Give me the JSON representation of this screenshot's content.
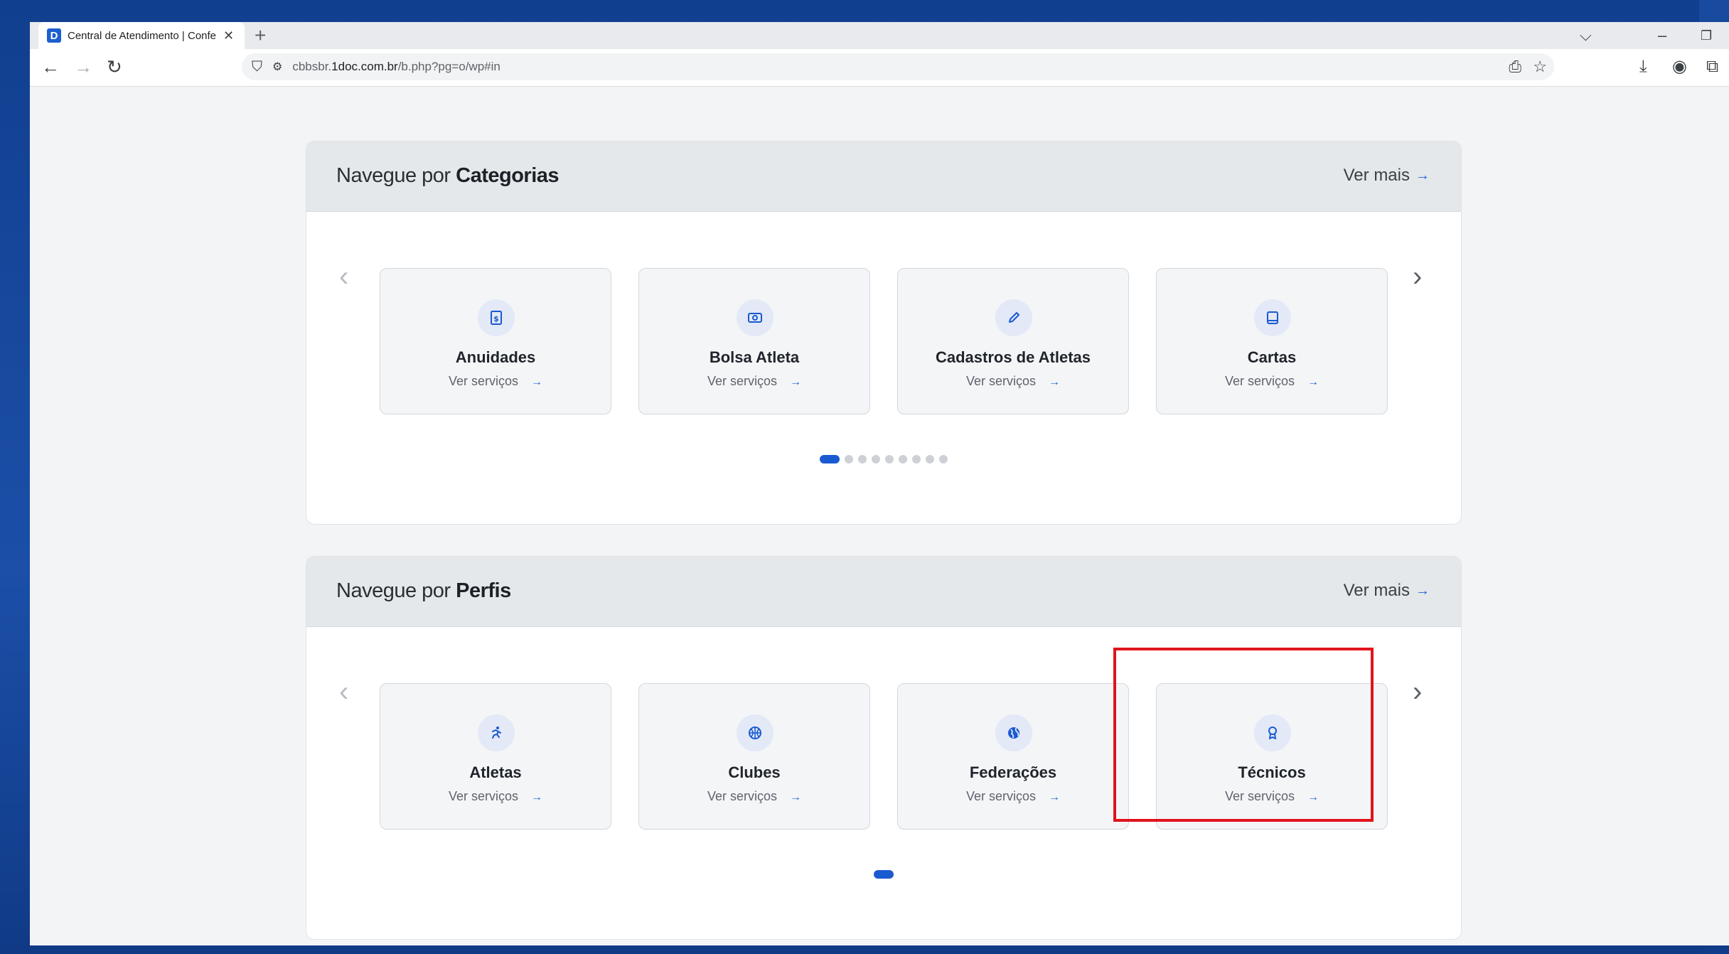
{
  "browser": {
    "tab": {
      "favicon_letter": "D",
      "title": "Central de Atendimento | Confe"
    },
    "address": {
      "prefix": "cbbsbr.",
      "host": "1doc.com.br",
      "path": "/b.php?pg=o/wp#in"
    }
  },
  "categories_section": {
    "title_prefix": "Navegue por",
    "title_bold": "Categorias",
    "ver_mais": "Ver mais",
    "cards": [
      {
        "title": "Anuidades",
        "link": "Ver serviços",
        "icon": "receipt-icon"
      },
      {
        "title": "Bolsa Atleta",
        "link": "Ver serviços",
        "icon": "money-icon"
      },
      {
        "title": "Cadastros de Atletas",
        "link": "Ver serviços",
        "icon": "pencil-icon"
      },
      {
        "title": "Cartas",
        "link": "Ver serviços",
        "icon": "book-icon"
      }
    ],
    "page_dots": 9,
    "active_dot": 0
  },
  "profiles_section": {
    "title_prefix": "Navegue por",
    "title_bold": "Perfis",
    "ver_mais": "Ver mais",
    "cards": [
      {
        "title": "Atletas",
        "link": "Ver serviços",
        "icon": "running-person-icon"
      },
      {
        "title": "Clubes",
        "link": "Ver serviços",
        "icon": "basketball-icon"
      },
      {
        "title": "Federações",
        "link": "Ver serviços",
        "icon": "globe-icon"
      },
      {
        "title": "Técnicos",
        "link": "Ver serviços",
        "icon": "award-icon"
      }
    ],
    "page_dots": 1,
    "active_dot": 0
  },
  "highlight_color": "#e0141b",
  "accent_color": "#1a5ad1"
}
